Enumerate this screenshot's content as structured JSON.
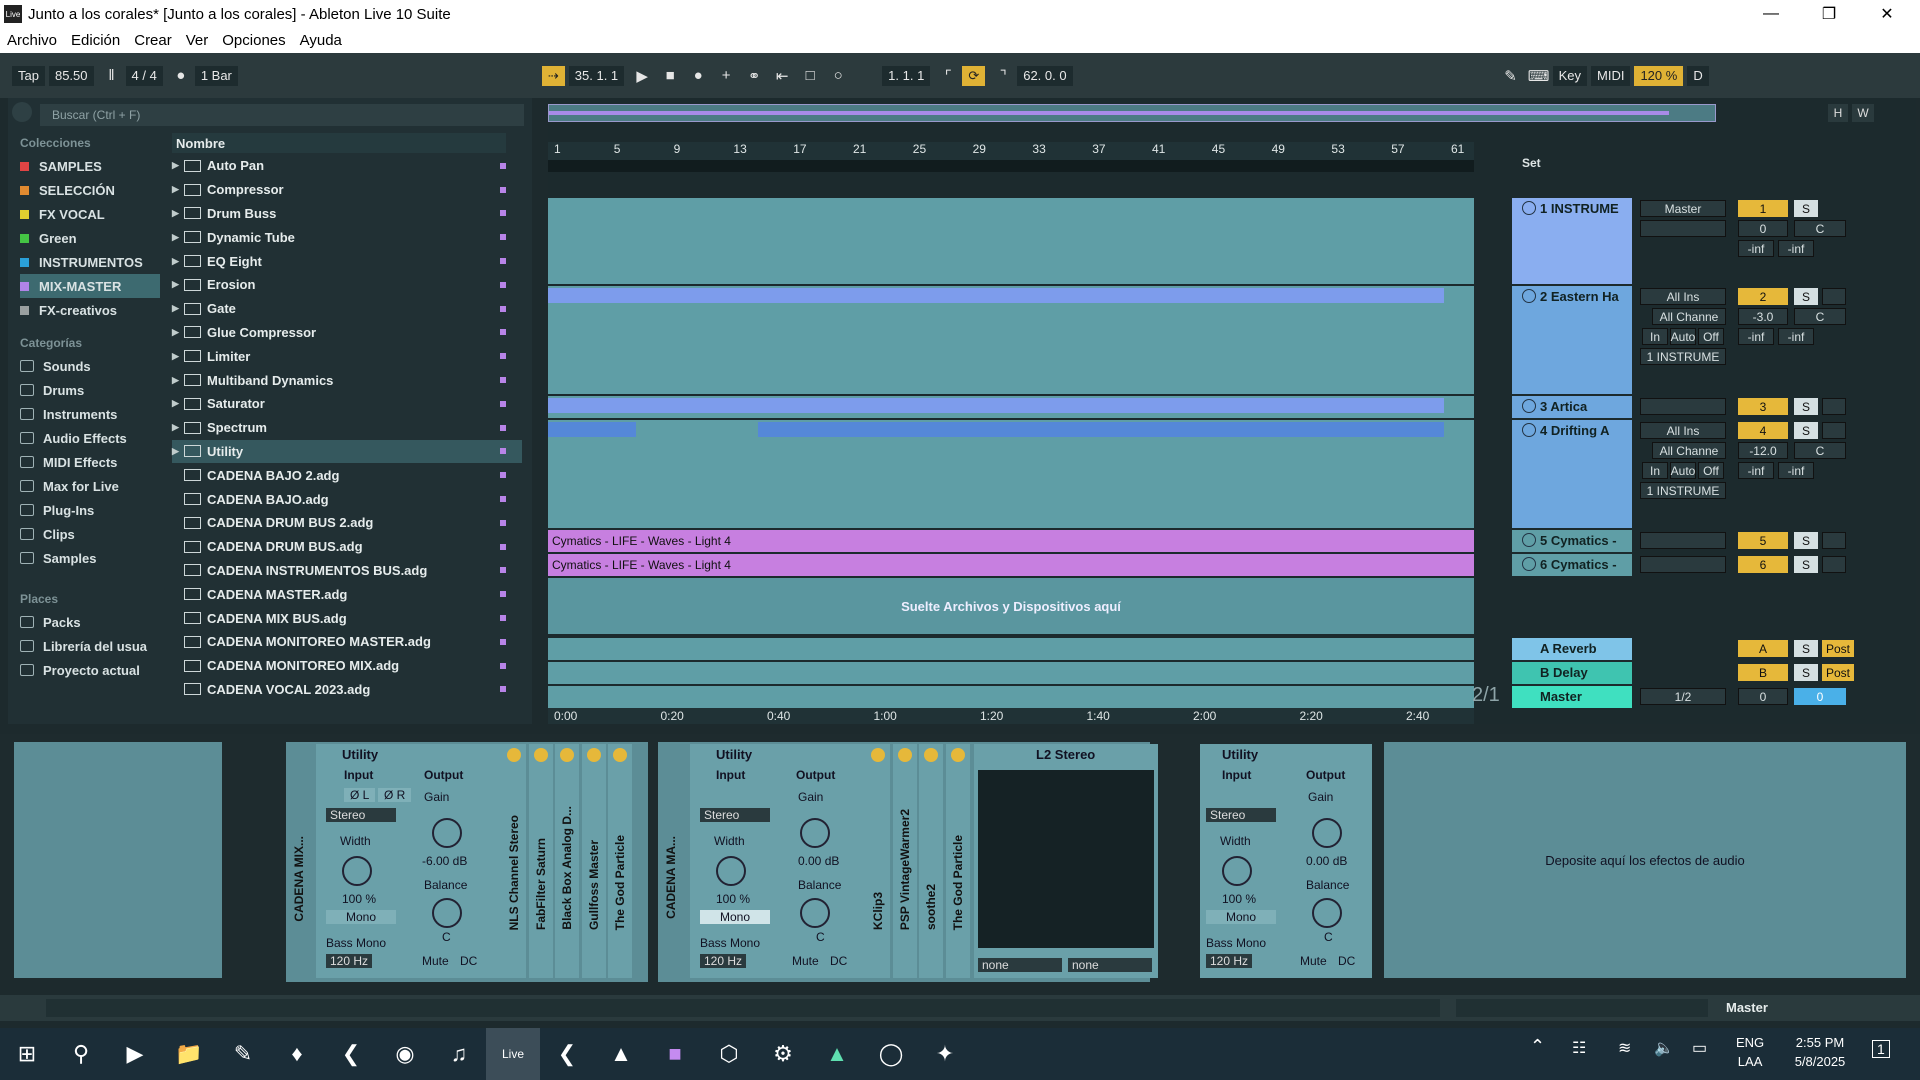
{
  "window": {
    "title": "Junto a los corales* [Junto a los corales] - Ableton Live 10 Suite",
    "app_icon": "Live"
  },
  "menu": [
    "Archivo",
    "Edición",
    "Crear",
    "Ver",
    "Opciones",
    "Ayuda"
  ],
  "control": {
    "tap": "Tap",
    "tempo": "85.50",
    "sig": "4 / 4",
    "quant": "1 Bar",
    "pos": "35.  1.  1",
    "loop_start": "1.  1.  1",
    "loop_len": "62.  0.  0",
    "key": "Key",
    "midi": "MIDI",
    "zoom": "120 %",
    "d": "D"
  },
  "browser": {
    "search_placeholder": "Buscar (Ctrl + F)",
    "collections_title": "Colecciones",
    "collections": [
      {
        "name": "SAMPLES",
        "color": "#e04444"
      },
      {
        "name": "SELECCIÓN",
        "color": "#e08a30"
      },
      {
        "name": "FX VOCAL",
        "color": "#e0d030"
      },
      {
        "name": "Green",
        "color": "#44c444"
      },
      {
        "name": "INSTRUMENTOS",
        "color": "#2aa0d8"
      },
      {
        "name": "MIX-MASTER",
        "color": "#b084e8"
      },
      {
        "name": "FX-creativos",
        "color": "#9aa0a0"
      }
    ],
    "categories_title": "Categorías",
    "categories": [
      "Sounds",
      "Drums",
      "Instruments",
      "Audio Effects",
      "MIDI Effects",
      "Max for Live",
      "Plug-Ins",
      "Clips",
      "Samples"
    ],
    "places_title": "Places",
    "places": [
      "Packs",
      "Librería del usua",
      "Proyecto actual"
    ],
    "name_header": "Nombre",
    "items": [
      "Auto Pan",
      "Compressor",
      "Drum Buss",
      "Dynamic Tube",
      "EQ Eight",
      "Erosion",
      "Gate",
      "Glue Compressor",
      "Limiter",
      "Multiband Dynamics",
      "Saturator",
      "Spectrum",
      "Utility",
      "CADENA BAJO 2.adg",
      "CADENA BAJO.adg",
      "CADENA DRUM BUS 2.adg",
      "CADENA DRUM BUS.adg",
      "CADENA INSTRUMENTOS BUS.adg",
      "CADENA MASTER.adg",
      "CADENA MIX BUS.adg",
      "CADENA MONITOREO MASTER.adg",
      "CADENA MONITOREO MIX.adg",
      "CADENA VOCAL 2023.adg"
    ]
  },
  "arrangement": {
    "ruler": [
      "1",
      "5",
      "9",
      "13",
      "17",
      "21",
      "25",
      "29",
      "33",
      "37",
      "41",
      "45",
      "49",
      "53",
      "57",
      "61"
    ],
    "time": [
      "0:00",
      "0:20",
      "0:40",
      "1:00",
      "1:20",
      "1:40",
      "2:00",
      "2:20",
      "2:40"
    ],
    "clip_a": "Cymatics - LIFE - Waves - Light 4",
    "clip_b": "Cymatics - LIFE - Waves - Light 4",
    "drop": "Suelte Archivos y Dispositivos aquí",
    "set": "Set",
    "hw": [
      "H",
      "W"
    ],
    "fraction": "2/1"
  },
  "tracks": [
    {
      "name": "1 INSTRUME",
      "route": "Master",
      "num": "1",
      "vol": "0",
      "pan": "C",
      "inf1": "-inf",
      "inf2": "-inf"
    },
    {
      "name": "2 Eastern Ha",
      "route": "All Ins",
      "ch": "All Channe",
      "num": "2",
      "vol": "-3.0",
      "pan": "C",
      "inf1": "-inf",
      "inf2": "-inf",
      "out": "1 INSTRUME",
      "mon": [
        "In",
        "Auto",
        "Off"
      ]
    },
    {
      "name": "3 Artica",
      "num": "3"
    },
    {
      "name": "4 Drifting A",
      "route": "All Ins",
      "ch": "All Channe",
      "num": "4",
      "vol": "-12.0",
      "pan": "C",
      "inf1": "-inf",
      "inf2": "-inf",
      "out": "1 INSTRUME",
      "mon": [
        "In",
        "Auto",
        "Off"
      ]
    },
    {
      "name": "5 Cymatics -",
      "num": "5"
    },
    {
      "name": "6 Cymatics -",
      "num": "6"
    }
  ],
  "returns": [
    {
      "name": "A Reverb",
      "num": "A",
      "post": "Post",
      "color": "#7fc4e8"
    },
    {
      "name": "B Delay",
      "num": "B",
      "post": "Post",
      "color": "#3fc4b0"
    }
  ],
  "master": {
    "name": "Master",
    "route": "1/2",
    "v1": "0",
    "v2": "0"
  },
  "solo": "S",
  "devices": {
    "chain1": "CADENA MIX...",
    "chain2": "CADENA MA...",
    "utility": {
      "title": "Utility",
      "input": "Input",
      "output": "Output",
      "gain": "Gain",
      "stereo": "Stereo",
      "width": "Width",
      "width_val": "100 %",
      "mono": "Mono",
      "balance": "Balance",
      "c": "C",
      "bass": "Bass Mono",
      "hz": "120 Hz",
      "mute": "Mute",
      "dc": "DC",
      "phl": "Ø L",
      "phr": "Ø R"
    },
    "gain1": "-6.00 dB",
    "gain2": "0.00 dB",
    "gain3": "0.00 dB",
    "plugins1": [
      "NLS Channel Stereo",
      "FabFilter Saturn",
      "Black Box Analog D...",
      "Gullfoss Master",
      "The God Particle"
    ],
    "plugins2": [
      "KClip3",
      "PSP VintageWarmer2",
      "soothe2",
      "The God Particle"
    ],
    "l2": "L2 Stereo",
    "none": "none",
    "drop_fx": "Deposite aquí los efectos de audio"
  },
  "status": {
    "master": "Master"
  },
  "taskbar": {
    "lang": "ENG",
    "lang2": "LAA",
    "time": "2:55 PM",
    "date": "5/8/2025",
    "notif": "1"
  }
}
